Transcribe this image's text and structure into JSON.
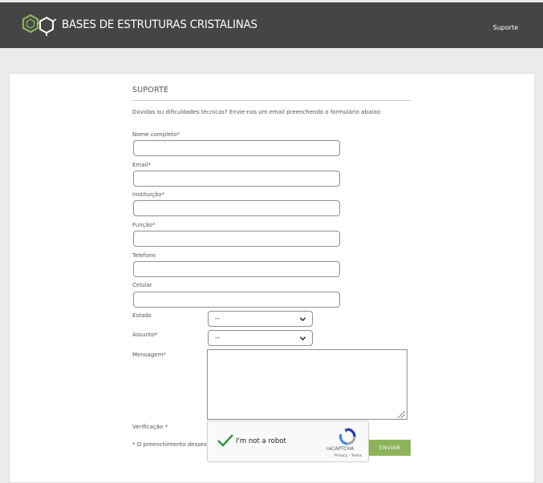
{
  "header": {
    "site_title": "BASES DE ESTRUTURAS CRISTALINAS",
    "nav_support": "Suporte",
    "logo_icon": "hexagon-molecule-icon",
    "accent_color": "#8eb45b",
    "bar_color": "#454545"
  },
  "support": {
    "title": "SUPORTE",
    "intro": "Dúvidas ou dificuldades técnicas? Envie-nos um email preenchendo o formulário abaixo:"
  },
  "form": {
    "full_name": {
      "label": "Nome completo*",
      "value": ""
    },
    "email": {
      "label": "Email*",
      "value": ""
    },
    "institution": {
      "label": "Instituição*",
      "value": ""
    },
    "role": {
      "label": "Função*",
      "value": ""
    },
    "phone": {
      "label": "Telefone",
      "value": ""
    },
    "mobile": {
      "label": "Celular",
      "value": ""
    },
    "state": {
      "label": "Estado",
      "selected": "--"
    },
    "subject": {
      "label": "Assunto*",
      "selected": "--"
    },
    "message": {
      "label": "Mensagem*",
      "value": ""
    },
    "verification": {
      "label": "Verificação *"
    },
    "required_note": "* O preenchimento desses",
    "submit_label": "ENVIAR"
  },
  "captcha": {
    "label": "I'm not a robot",
    "brand": "reCAPTCHA",
    "links": "Privacy - Terms",
    "check_color": "#2e9d48"
  }
}
